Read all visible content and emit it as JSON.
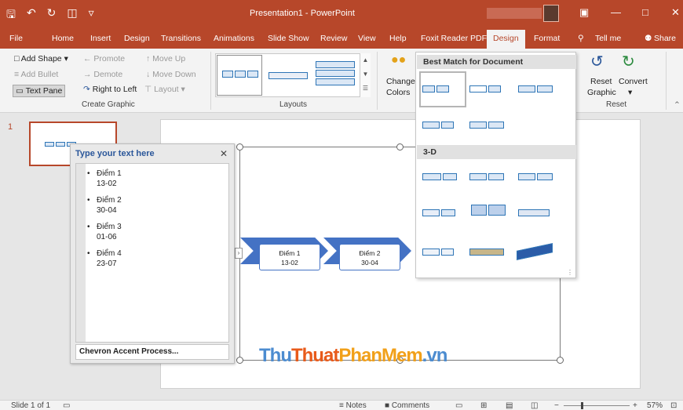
{
  "window": {
    "title": "Presentation1 - PowerPoint",
    "qat_icons": [
      "save-icon",
      "undo-icon",
      "redo-icon",
      "present-icon",
      "customize-icon"
    ]
  },
  "tabs": [
    "File",
    "Home",
    "Insert",
    "Design",
    "Transitions",
    "Animations",
    "Slide Show",
    "Review",
    "View",
    "Help",
    "Foxit Reader PDF",
    "Design",
    "Format"
  ],
  "tell_me": "Tell me",
  "share": "Share",
  "ribbon": {
    "add_shape": "Add Shape",
    "add_bullet": "Add Bullet",
    "text_pane": "Text Pane",
    "promote": "Promote",
    "demote": "Demote",
    "right_to_left": "Right to Left",
    "move_up": "Move Up",
    "move_down": "Move Down",
    "layout": "Layout",
    "create_graphic": "Create Graphic",
    "layouts": "Layouts",
    "change_colors_1": "Change",
    "change_colors_2": "Colors",
    "reset_graphic_1": "Reset",
    "reset_graphic_2": "Graphic",
    "convert": "Convert",
    "reset_group": "Reset"
  },
  "slides": {
    "number": "1"
  },
  "text_pane": {
    "title": "Type your text here",
    "items": [
      {
        "title": "Điểm 1",
        "date": "13-02"
      },
      {
        "title": "Điểm 2",
        "date": "30-04"
      },
      {
        "title": "Điểm 3",
        "date": "01-06"
      },
      {
        "title": "Điểm 4",
        "date": "23-07"
      }
    ],
    "footer": "Chevron Accent Process..."
  },
  "smartart": {
    "nodes": [
      {
        "title": "Điểm 1",
        "date": "13-02"
      },
      {
        "title": "Điểm 2",
        "date": "30-04"
      }
    ]
  },
  "gallery": {
    "best_match": "Best Match for Document",
    "three_d": "3-D"
  },
  "watermark": {
    "part1": "Thu",
    "part2": "Thuat",
    "part3": "PhanMem",
    "part4": ".vn"
  },
  "statusbar": {
    "slide_of": "Slide 1 of 1",
    "notes": "Notes",
    "comments": "Comments",
    "zoom": "57%"
  },
  "colors": {
    "accent": "#b7472a",
    "smartart": "#4472c4"
  }
}
